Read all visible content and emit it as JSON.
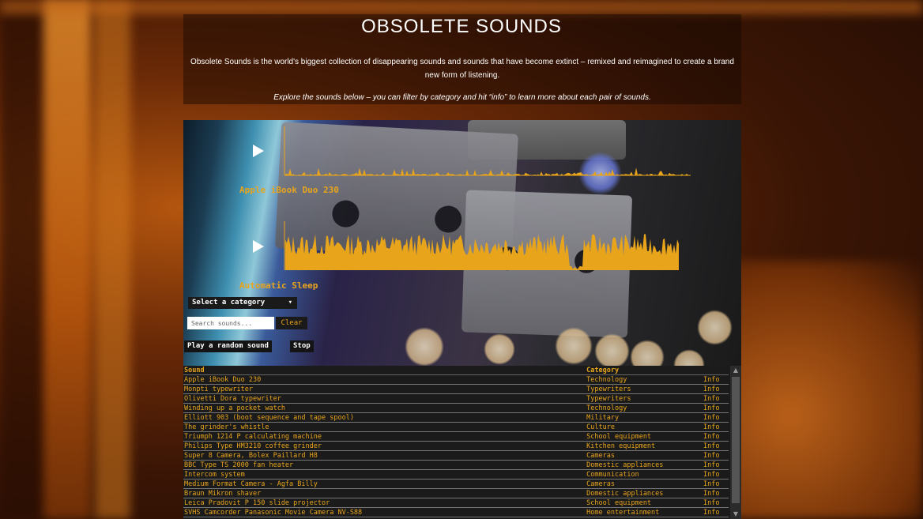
{
  "header": {
    "title": "OBSOLETE SOUNDS",
    "intro": "Obsolete Sounds is the world's biggest collection of disappearing sounds and sounds that have become extinct – remixed and reimagined to create a brand new form of listening.",
    "explore": "Explore the sounds below – you can filter by category and hit “info” to learn more about each pair of sounds."
  },
  "player": {
    "tracks": [
      {
        "label": "Apple iBook Duo 230",
        "play_icon": "play-icon"
      },
      {
        "label": "Automatic Sleep",
        "play_icon": "play-icon"
      }
    ],
    "accent_color": "#e8a51c"
  },
  "controls": {
    "category_select": "Select a category",
    "search_placeholder": "Search sounds...",
    "clear_label": "Clear",
    "random_label": "Play a random sound",
    "stop_label": "Stop"
  },
  "table": {
    "headers": [
      "Sound",
      "Category",
      ""
    ],
    "rows": [
      [
        "Apple iBook Duo 230",
        "Technology",
        "Info"
      ],
      [
        "Monpti typewriter",
        "Typewriters",
        "Info"
      ],
      [
        "Olivetti Dora typewriter",
        "Typewriters",
        "Info"
      ],
      [
        "Winding up a pocket watch",
        "Technology",
        "Info"
      ],
      [
        "Elliott 903 (boot sequence and tape spool)",
        "Military",
        "Info"
      ],
      [
        "The grinder's whistle",
        "Culture",
        "Info"
      ],
      [
        "Triumph 1214 P calculating machine",
        "School equipment",
        "Info"
      ],
      [
        "Philips Type HM3210 coffee grinder",
        "Kitchen equipment",
        "Info"
      ],
      [
        "Super 8 Camera, Bolex Paillard H8",
        "Cameras",
        "Info"
      ],
      [
        "BBC Type TS 2000 fan heater",
        "Domestic appliances",
        "Info"
      ],
      [
        "Intercom system",
        "Communication",
        "Info"
      ],
      [
        "Medium Format Camera - Agfa Billy",
        "Cameras",
        "Info"
      ],
      [
        "Braun Mikron shaver",
        "Domestic appliances",
        "Info"
      ],
      [
        "Leica Pradovit P 150 slide projector",
        "School equipment",
        "Info"
      ],
      [
        "SVHS Camcorder Panasonic Movie Camera NV-S88",
        "Home entertainment",
        "Info"
      ]
    ]
  }
}
